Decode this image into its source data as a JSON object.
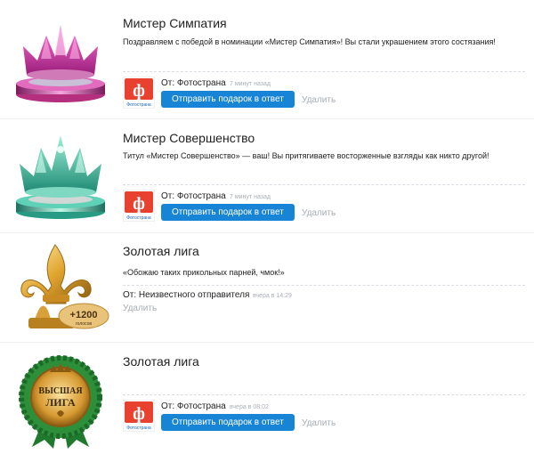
{
  "gifts": [
    {
      "title": "Мистер Симпатия",
      "message": "Поздравляем с победой в номинации «Мистер Симпатия»! Вы стали украшением этого состязания!",
      "from_label": "От: Фотострана",
      "time": "7 минут назад",
      "reply_label": "Отправить подарок в ответ",
      "delete_label": "Удалить",
      "avatar_text": "Фотострана"
    },
    {
      "title": "Мистер Совершенство",
      "message": "Титул «Мистер Совершенство» — ваш! Вы притягиваете восторженные взгляды как никто другой!",
      "from_label": "От: Фотострана",
      "time": "7 минут назад",
      "reply_label": "Отправить подарок в ответ",
      "delete_label": "Удалить",
      "avatar_text": "Фотострана"
    },
    {
      "title": "Золотая лига",
      "message": "«Обожаю таких прикольных парней, чмок!»",
      "from_label": "От: Неизвестного отправителя",
      "time": "вчера в 14:29",
      "delete_label": "Удалить",
      "badge_number": "+1200",
      "badge_text": "голосов"
    },
    {
      "title": "Золотая лига",
      "from_label": "От: Фотострана",
      "time": "вчера в 08:02",
      "reply_label": "Отправить подарок в ответ",
      "delete_label": "Удалить",
      "avatar_text": "Фотострана",
      "medal_line1": "ВЫСШАЯ",
      "medal_line2": "ЛИГА"
    }
  ],
  "colors": {
    "button": "#1784d6",
    "avatar": "#e8412f",
    "muted": "#a9aeb5"
  }
}
